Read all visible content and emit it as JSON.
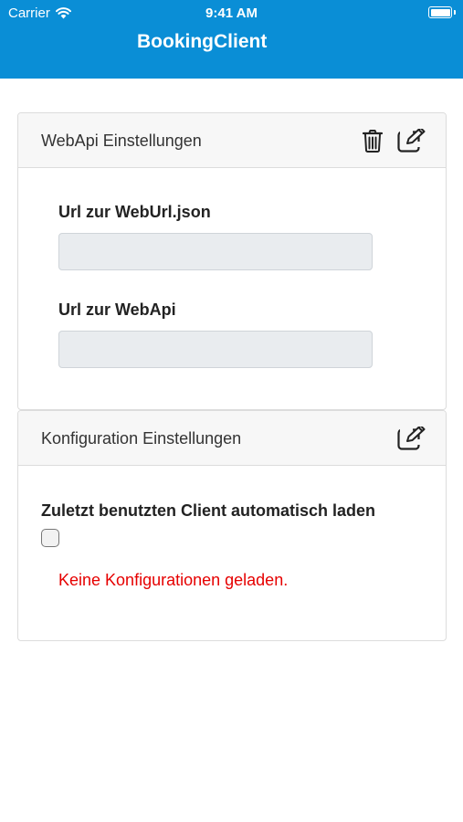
{
  "status_bar": {
    "carrier": "Carrier",
    "time": "9:41 AM"
  },
  "header": {
    "title": "BookingClient",
    "color": "#0a8ed6"
  },
  "webapi_card": {
    "title": "WebApi Einstellungen",
    "icons": [
      "trash-icon",
      "edit-icon"
    ],
    "fields": [
      {
        "label": "Url zur WebUrl.json",
        "value": ""
      },
      {
        "label": "Url zur WebApi",
        "value": ""
      }
    ]
  },
  "config_card": {
    "title": "Konfiguration Einstellungen",
    "icons": [
      "edit-icon"
    ],
    "autoload_label": "Zuletzt benutzten Client automatisch laden",
    "autoload_checked": false,
    "error_message": "Keine Konfigurationen geladen.",
    "error_color": "#e60000"
  }
}
